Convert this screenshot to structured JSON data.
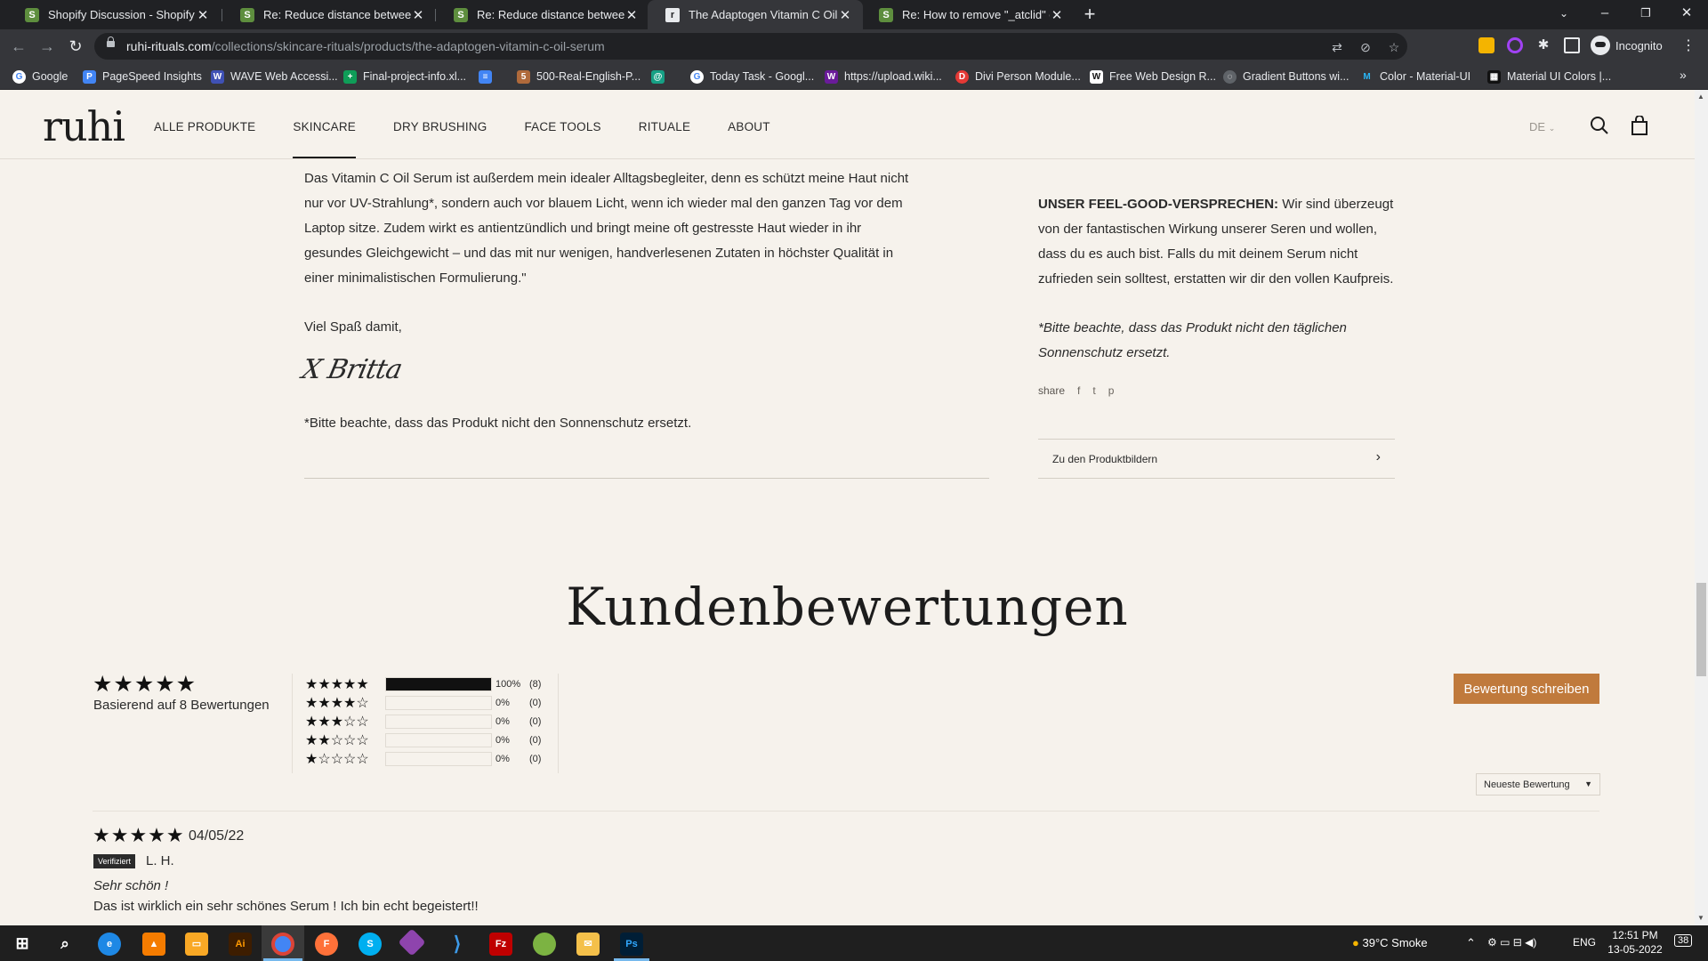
{
  "browser": {
    "tabs": [
      {
        "title": "Shopify Discussion - Shopify Con",
        "favicon": "shopify-icon",
        "active": false
      },
      {
        "title": "Re: Reduce distance between ima",
        "favicon": "shopify-icon",
        "active": false
      },
      {
        "title": "Re: Reduce distance between ima",
        "favicon": "shopify-icon",
        "active": false
      },
      {
        "title": "The Adaptogen Vitamin C Oil Ser",
        "favicon": "ruhi-icon",
        "active": true
      },
      {
        "title": "Re: How to remove \"_atclid\" code",
        "favicon": "shopify-icon",
        "active": false
      }
    ],
    "url_host": "ruhi-rituals.com",
    "url_path": "/collections/skincare-rituals/products/the-adaptogen-vitamin-c-oil-serum",
    "profile_label": "Incognito",
    "bookmarks": [
      "Google",
      "PageSpeed Insights",
      "WAVE Web Accessi...",
      "Final-project-info.xl...",
      "",
      "500-Real-English-P...",
      "",
      "Today Task - Googl...",
      "https://upload.wiki...",
      "Divi Person Module...",
      "Free Web Design R...",
      "Gradient Buttons wi...",
      "Color - Material-UI",
      "Material UI Colors |..."
    ]
  },
  "site": {
    "logo": "ruhi",
    "nav": [
      "ALLE PRODUKTE",
      "SKINCARE",
      "DRY BRUSHING",
      "FACE TOOLS",
      "RITUALE",
      "ABOUT"
    ],
    "active_nav": "SKINCARE",
    "language": "DE"
  },
  "product": {
    "story_paragraph": "Das Vitamin C Oil Serum ist außerdem mein idealer Alltagsbegleiter, denn es schützt meine Haut nicht nur vor UV-Strahlung*, sondern auch vor blauem Licht, wenn ich wieder mal den ganzen Tag vor dem Laptop sitze. Zudem wirkt es antientzündlich und bringt meine oft gestresste Haut wieder in ihr gesundes Gleichgewicht – und das mit nur wenigen, handverlesenen Zutaten in höchster Qualität in einer minimalistischen Formulierung.\"",
    "closing": "Viel Spaß damit,",
    "signature": "X Britta",
    "disclaimer": "*Bitte beachte, dass das Produkt nicht den Sonnenschutz ersetzt.",
    "promise_heading": "UNSER FEEL-GOOD-VERSPRECHEN:",
    "promise_text": " Wir sind überzeugt von der fantastischen Wirkung unserer Seren und wollen, dass du es auch bist. Falls du mit deinem Serum nicht zufrieden sein solltest, erstatten wir dir den vollen Kaufpreis.",
    "promise_note": "*Bitte beachte, dass das Produkt nicht den täglichen Sonnenschutz ersetzt.",
    "share_label": "share",
    "to_images_label": "Zu den Produktbildern"
  },
  "reviews": {
    "title": "Kundenbewertungen",
    "average_stars": "★★★★★",
    "based_on": "Basierend auf 8 Bewertungen",
    "histogram": [
      {
        "stars": "★★★★★",
        "percent": "100%",
        "count": "(8)",
        "fill": 1.0
      },
      {
        "stars": "★★★★☆",
        "percent": "0%",
        "count": "(0)",
        "fill": 0
      },
      {
        "stars": "★★★☆☆",
        "percent": "0%",
        "count": "(0)",
        "fill": 0
      },
      {
        "stars": "★★☆☆☆",
        "percent": "0%",
        "count": "(0)",
        "fill": 0
      },
      {
        "stars": "★☆☆☆☆",
        "percent": "0%",
        "count": "(0)",
        "fill": 0
      }
    ],
    "write_button": "Bewertung schreiben",
    "sort_value": "Neueste Bewertung",
    "items": [
      {
        "stars": "★★★★★",
        "date": "04/05/22",
        "badge": "Verifiziert",
        "author": "L. H.",
        "title": "Sehr schön !",
        "body": "Das ist wirklich ein sehr schönes Serum ! Ich bin echt begeistert!!"
      }
    ]
  },
  "taskbar": {
    "weather": "39°C  Smoke",
    "language": "ENG",
    "time": "12:51 PM",
    "date": "13-05-2022",
    "notifications": "38"
  },
  "colors": {
    "page_bg": "#f6f2ec",
    "accent": "#c07a3c",
    "text": "#2b2b2b"
  }
}
